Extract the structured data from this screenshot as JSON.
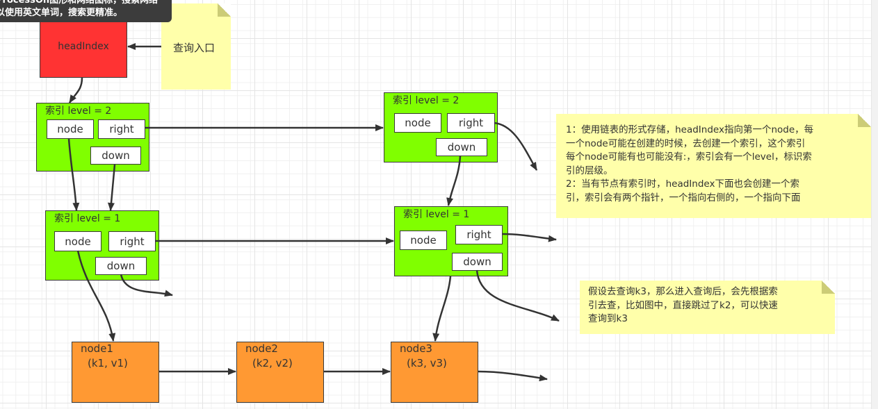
{
  "tooltip": {
    "lines": [
      "ProcessOn图形和网络图标，搜索网络",
      "以使用英文单词，搜索更精准。"
    ]
  },
  "head_index": {
    "label": "headIndex"
  },
  "entry_note": {
    "text": "查询入口"
  },
  "index_level2_left": {
    "title": "索引   level = 2",
    "node": "node",
    "right": "right",
    "down": "down"
  },
  "index_level2_right": {
    "title": "索引   level = 2",
    "node": "node",
    "right": "right",
    "down": "down"
  },
  "index_level1_left": {
    "title": "索引   level = 1",
    "node": "node",
    "right": "right",
    "down": "down"
  },
  "index_level1_right": {
    "title": "索引   level = 1",
    "node": "node",
    "right": "right",
    "down": "down"
  },
  "nodes": [
    {
      "name": "node1",
      "kv": "(k1, v1)"
    },
    {
      "name": "node2",
      "kv": "(k2, v2)"
    },
    {
      "name": "node3",
      "kv": "(k3, v3)"
    }
  ],
  "note_structure": {
    "text": "1：使用链表的形式存储，headIndex指向第一个node，每\n一个node可能在创建的时候，去创建一个索引，这个索引\n每个node可能有也可能没有:，索引会有一个level，标识索\n引的层级。\n2：当有节点有索引时，headIndex下面也会创建一个索\n引，索引会有两个指针，一个指向右侧的，一个指向下面"
  },
  "note_query": {
    "text": "假设去查询k3，那么进入查询后，会先根据索\n引去查，比如图中，直接跳过了k2，可以快速\n查询到k3"
  },
  "colors": {
    "head": "#ff3333",
    "index": "#80ff00",
    "node": "#ff9933",
    "note": "#ffffaa",
    "arrow": "#333333"
  }
}
